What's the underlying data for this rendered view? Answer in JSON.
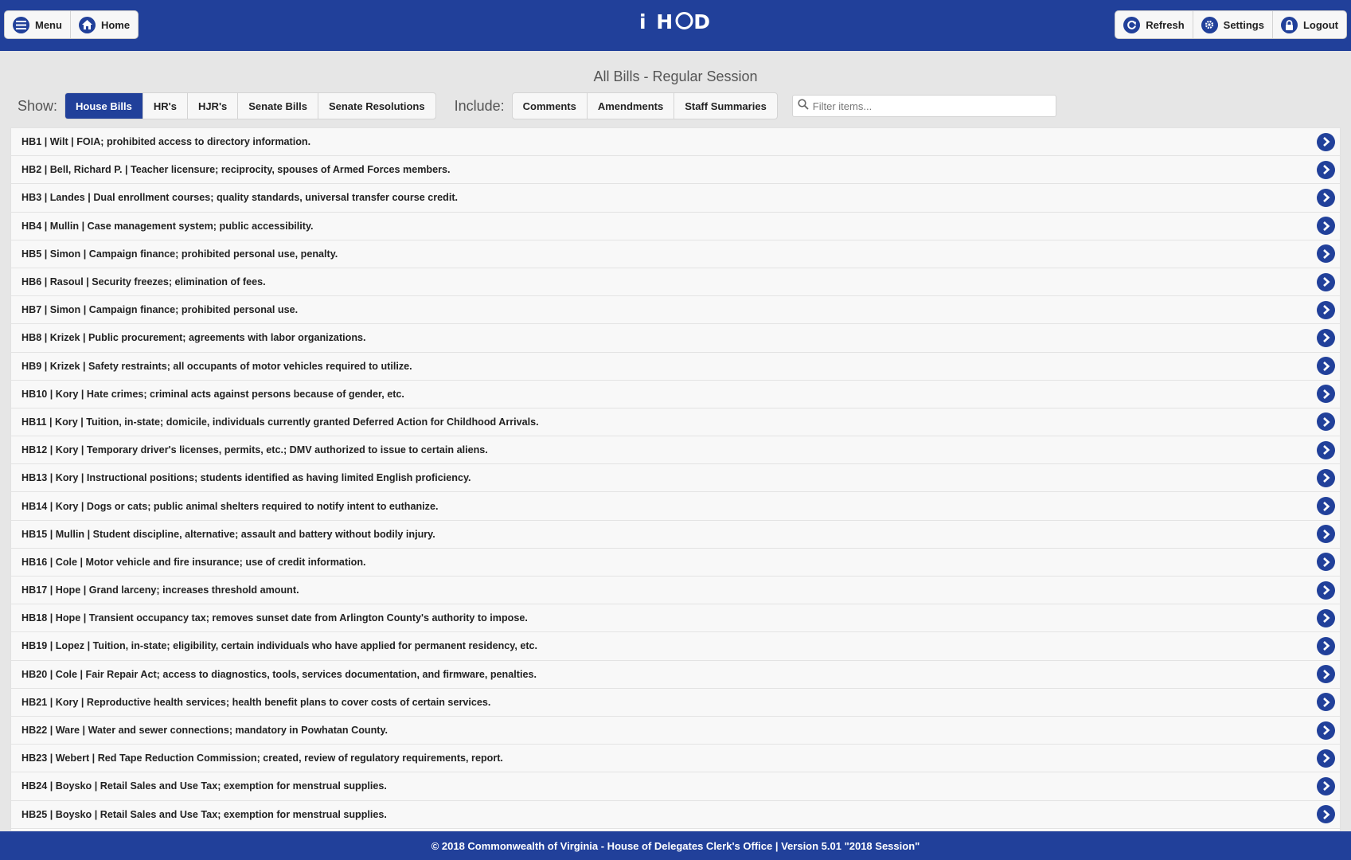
{
  "header": {
    "menu_label": "Menu",
    "home_label": "Home",
    "logo_left": "i H",
    "logo_right": "D",
    "refresh_label": "Refresh",
    "settings_label": "Settings",
    "logout_label": "Logout"
  },
  "page_title": "All Bills - Regular Session",
  "filters": {
    "show_label": "Show:",
    "show_options": [
      "House Bills",
      "HR's",
      "HJR's",
      "Senate Bills",
      "Senate Resolutions"
    ],
    "active_show": "House Bills",
    "include_label": "Include:",
    "include_options": [
      "Comments",
      "Amendments",
      "Staff Summaries"
    ],
    "search_placeholder": "Filter items..."
  },
  "bills": [
    "HB1 | Wilt | FOIA; prohibited access to directory information.",
    "HB2 | Bell, Richard P. | Teacher licensure; reciprocity, spouses of Armed Forces members.",
    "HB3 | Landes | Dual enrollment courses; quality standards, universal transfer course credit.",
    "HB4 | Mullin | Case management system; public accessibility.",
    "HB5 | Simon | Campaign finance; prohibited personal use, penalty.",
    "HB6 | Rasoul | Security freezes; elimination of fees.",
    "HB7 | Simon | Campaign finance; prohibited personal use.",
    "HB8 | Krizek | Public procurement; agreements with labor organizations.",
    "HB9 | Krizek | Safety restraints; all occupants of motor vehicles required to utilize.",
    "HB10 | Kory | Hate crimes; criminal acts against persons because of gender, etc.",
    "HB11 | Kory | Tuition, in-state; domicile, individuals currently granted Deferred Action for Childhood Arrivals.",
    "HB12 | Kory | Temporary driver's licenses, permits, etc.; DMV authorized to issue to certain aliens.",
    "HB13 | Kory | Instructional positions; students identified as having limited English proficiency.",
    "HB14 | Kory | Dogs or cats; public animal shelters required to notify intent to euthanize.",
    "HB15 | Mullin | Student discipline, alternative; assault and battery without bodily injury.",
    "HB16 | Cole | Motor vehicle and fire insurance; use of credit information.",
    "HB17 | Hope | Grand larceny; increases threshold amount.",
    "HB18 | Hope | Transient occupancy tax; removes sunset date from Arlington County's authority to impose.",
    "HB19 | Lopez | Tuition, in-state; eligibility, certain individuals who have applied for permanent residency, etc.",
    "HB20 | Cole | Fair Repair Act; access to diagnostics, tools, services documentation, and firmware, penalties.",
    "HB21 | Kory | Reproductive health services; health benefit plans to cover costs of certain services.",
    "HB22 | Ware | Water and sewer connections; mandatory in Powhatan County.",
    "HB23 | Webert | Red Tape Reduction Commission; created, review of regulatory requirements, report.",
    "HB24 | Boysko | Retail Sales and Use Tax; exemption for menstrual supplies.",
    "HB25 | Boysko | Retail Sales and Use Tax; exemption for menstrual supplies."
  ],
  "footer": "© 2018 Commonwealth of Virginia - House of Delegates Clerk's Office | Version 5.01 \"2018 Session\"",
  "colors": {
    "primary": "#21409a",
    "background": "#e6e6e6",
    "row": "#f8f8f8"
  },
  "icons": [
    "menu-icon",
    "home-icon",
    "refresh-icon",
    "settings-icon",
    "lock-icon",
    "search-icon",
    "chevron-right-icon"
  ]
}
